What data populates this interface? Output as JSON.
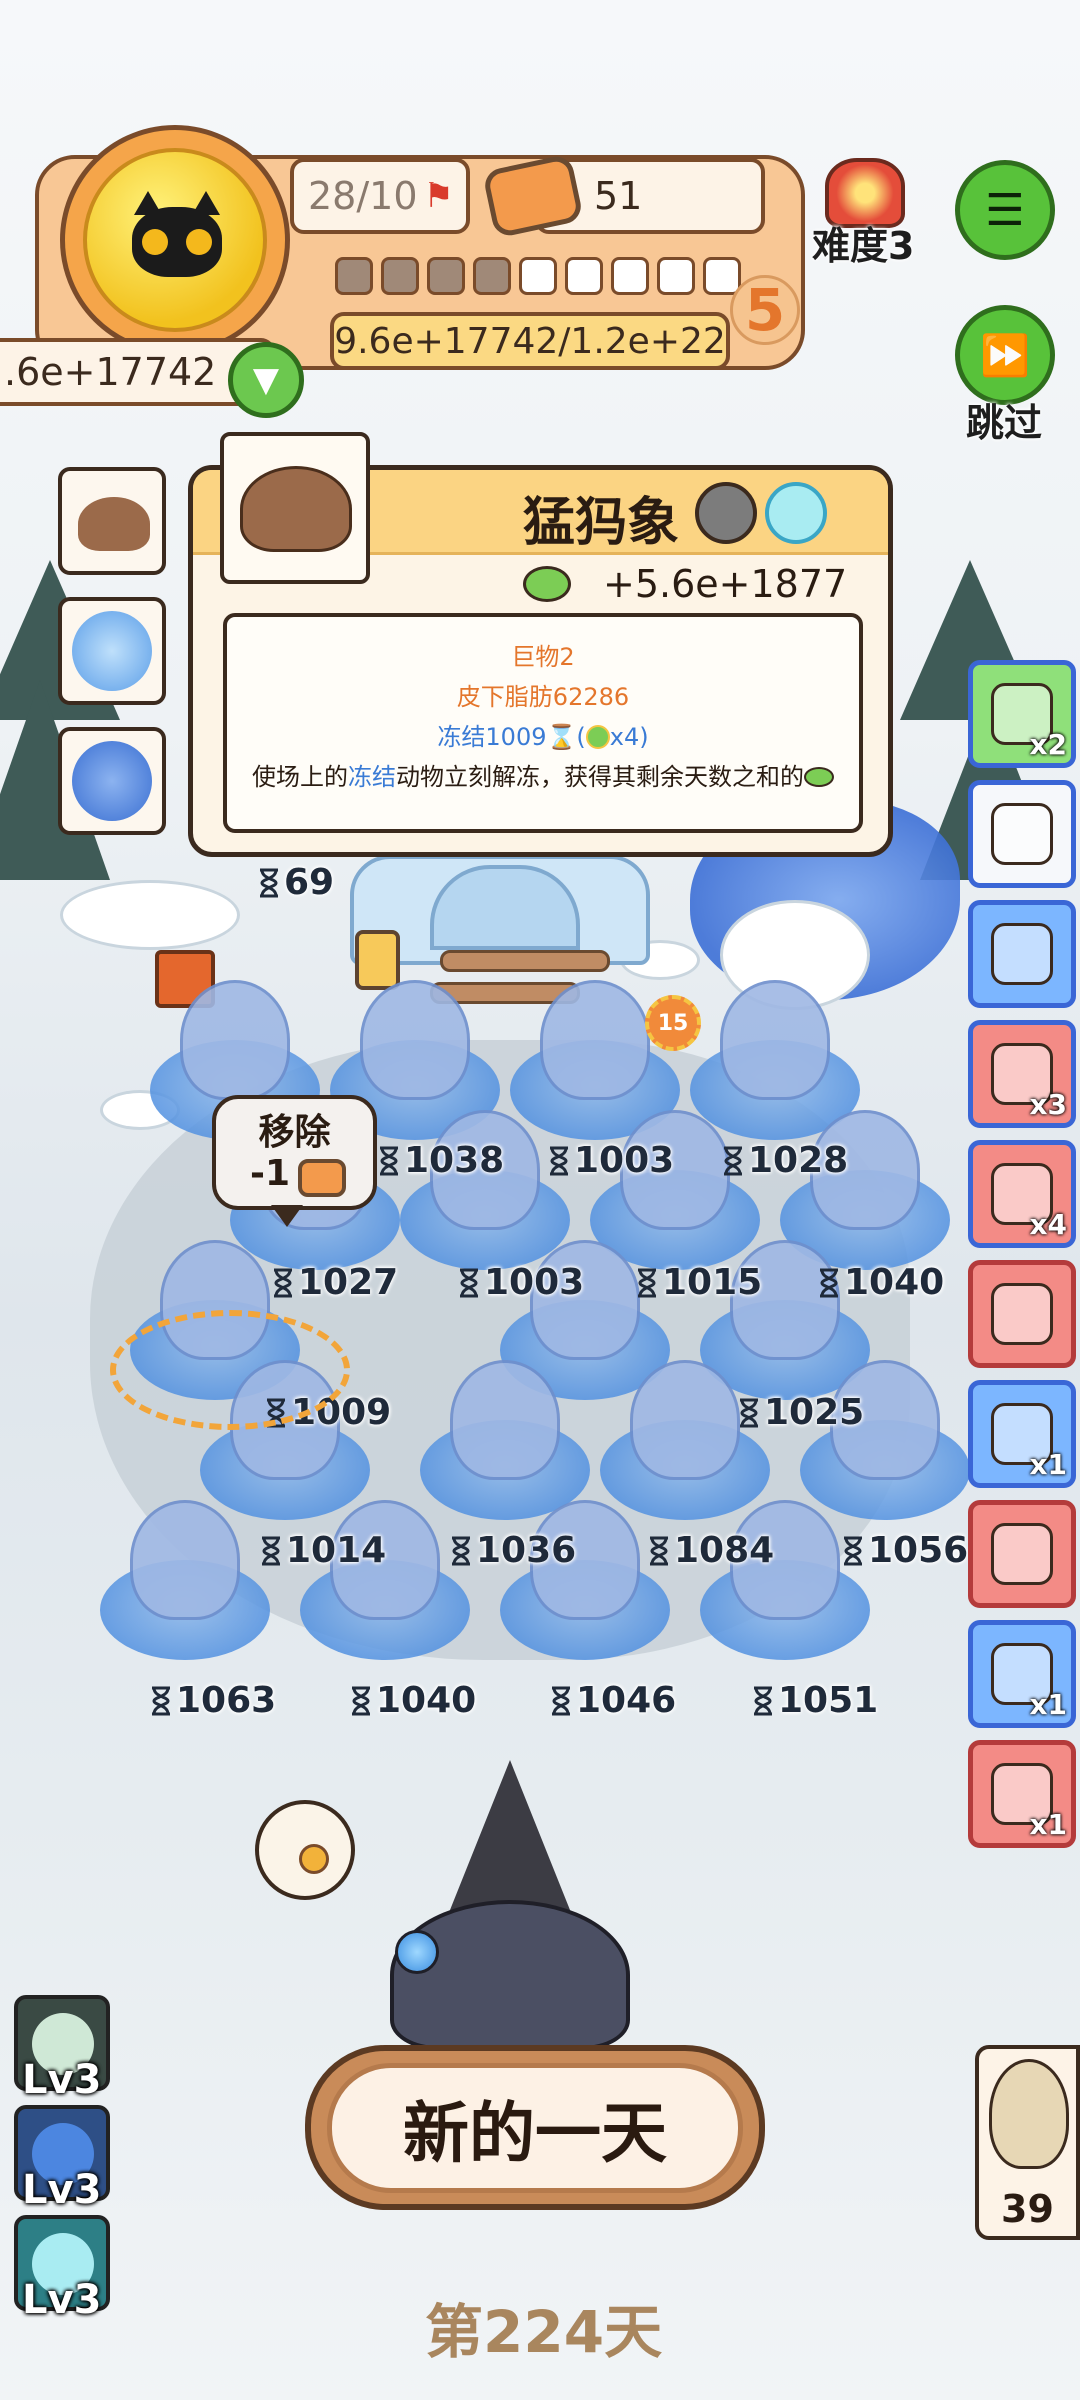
{
  "hud": {
    "stage_progress": "28/10",
    "tins_count": "51",
    "difficulty": "难度3",
    "score_left": ".6e+17742",
    "score_bar": "9.6e+17742/1.2e+22",
    "level": "5",
    "segments_filled": 4,
    "segments_total": 9,
    "skip_label": "跳过"
  },
  "card": {
    "title": "猛犸象",
    "gain": "+5.6e+1877",
    "line1": "巨物2",
    "line2": "皮下脂肪62286",
    "line3_prefix": "冻结1009",
    "line3_mid": "(",
    "line3_suffix": "x4)",
    "desc_a": "使场上的",
    "desc_highlight": "冻结",
    "desc_b": "动物立刻解冻，获得其剩余天数之和的"
  },
  "field": {
    "top_counter": "69",
    "flower_badge": "15",
    "remove_label": "移除",
    "remove_cost": "-1",
    "counters": [
      "1038",
      "1003",
      "1028",
      "1027",
      "1003",
      "1015",
      "1040",
      "1009",
      "1025",
      "1014",
      "1036",
      "1084",
      "1056",
      "1063",
      "1040",
      "1046",
      "1051"
    ]
  },
  "items": [
    {
      "count": "x2",
      "icon": "tea-cup-icon"
    },
    {
      "count": "",
      "icon": "purple-card-icon"
    },
    {
      "count": "",
      "icon": "discount-ticket-icon"
    },
    {
      "count": "x3",
      "icon": "diving-mask-icon"
    },
    {
      "count": "x4",
      "icon": "turtle-shell-icon"
    },
    {
      "count": "",
      "icon": "cloud-icon"
    },
    {
      "count": "x1",
      "icon": "flying-fish-icon"
    },
    {
      "count": "",
      "icon": "mittens-icon"
    },
    {
      "count": "x1",
      "icon": "hockey-stick-icon"
    },
    {
      "count": "x1",
      "icon": "gift-bag-icon"
    }
  ],
  "bottom": {
    "new_day": "新的一天",
    "day_label": "第224天",
    "owl_count": "39",
    "lv_labels": [
      "Lv3",
      "Lv3",
      "Lv3"
    ]
  },
  "colors": {
    "accent_green": "#58c23a",
    "panel_orange": "#f8c795",
    "ice_blue": "#4f8fe0",
    "text_orange": "#e4762c",
    "text_blue": "#3a7bd5"
  }
}
